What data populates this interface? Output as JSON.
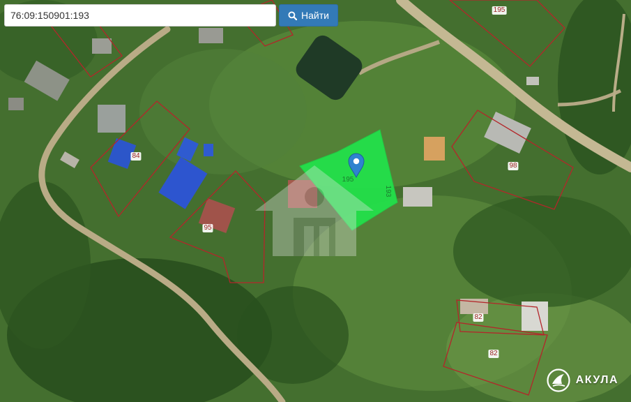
{
  "search": {
    "value": "76:09:150901:193",
    "button_label": "Найти",
    "button_icon": "magnifier-icon"
  },
  "parcels": {
    "label_195_top": "195",
    "label_84": "84",
    "label_95": "95",
    "label_98": "98",
    "label_193": "193",
    "label_195_target": "195",
    "label_82_top": "82",
    "label_82_bottom": "82"
  },
  "brand": {
    "name": "АКУЛА"
  },
  "colors": {
    "boundary": "#b3262a",
    "selected_parcel": "#22e34b",
    "button": "#337ab7"
  }
}
